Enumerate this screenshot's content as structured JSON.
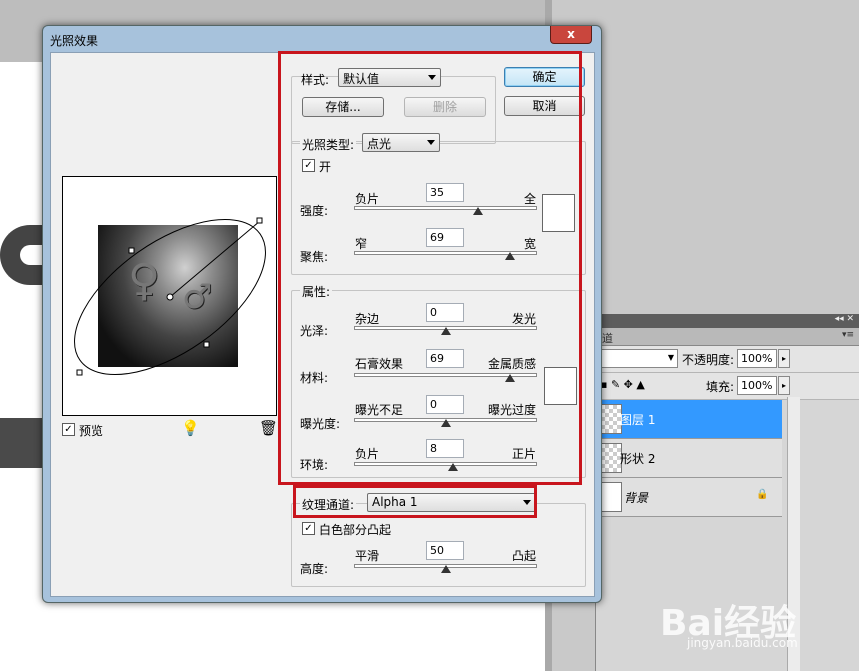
{
  "dialog": {
    "title": "光照效果",
    "close": "x",
    "preview_label": "预览",
    "preview_checked": true,
    "ok": "确定",
    "cancel": "取消"
  },
  "style_group": {
    "label": "样式:",
    "value": "默认值",
    "save": "存储...",
    "delete": "删除"
  },
  "light_group": {
    "type_label": "光照类型:",
    "type_value": "点光",
    "on_label": "开",
    "on_checked": true,
    "intensity": {
      "label": "强度:",
      "min": "负片",
      "max": "全",
      "value": "35",
      "fraction": 0.68
    },
    "focus": {
      "label": "聚焦:",
      "min": "窄",
      "max": "宽",
      "value": "69",
      "fraction": 0.85
    }
  },
  "properties_group": {
    "label": "属性:",
    "gloss": {
      "label": "光泽:",
      "min": "杂边",
      "max": "发光",
      "value": "0",
      "fraction": 0.5
    },
    "material": {
      "label": "材料:",
      "min": "石膏效果",
      "max": "金属质感",
      "value": "69",
      "fraction": 0.85
    },
    "exposure": {
      "label": "曝光度:",
      "min": "曝光不足",
      "max": "曝光过度",
      "value": "0",
      "fraction": 0.5
    },
    "ambience": {
      "label": "环境:",
      "min": "负片",
      "max": "正片",
      "value": "8",
      "fraction": 0.54
    }
  },
  "texture_group": {
    "label": "纹理通道:",
    "value": "Alpha 1",
    "white_high_label": "白色部分凸起",
    "white_high_checked": true,
    "height": {
      "label": "高度:",
      "min": "平滑",
      "max": "凸起",
      "value": "50",
      "fraction": 0.5
    }
  },
  "layers_panel": {
    "tab": "道",
    "opacity_label": "不透明度:",
    "opacity_value": "100%",
    "fill_label": "填充:",
    "fill_value": "100%",
    "layers": [
      "图层 1",
      "形状 2",
      "背景"
    ]
  },
  "watermark": {
    "brand": "Bai经验",
    "url": "jingyan.baidu.com"
  },
  "colors": {
    "highlight_box": "#c8151d",
    "selected_layer": "#3399ff"
  }
}
